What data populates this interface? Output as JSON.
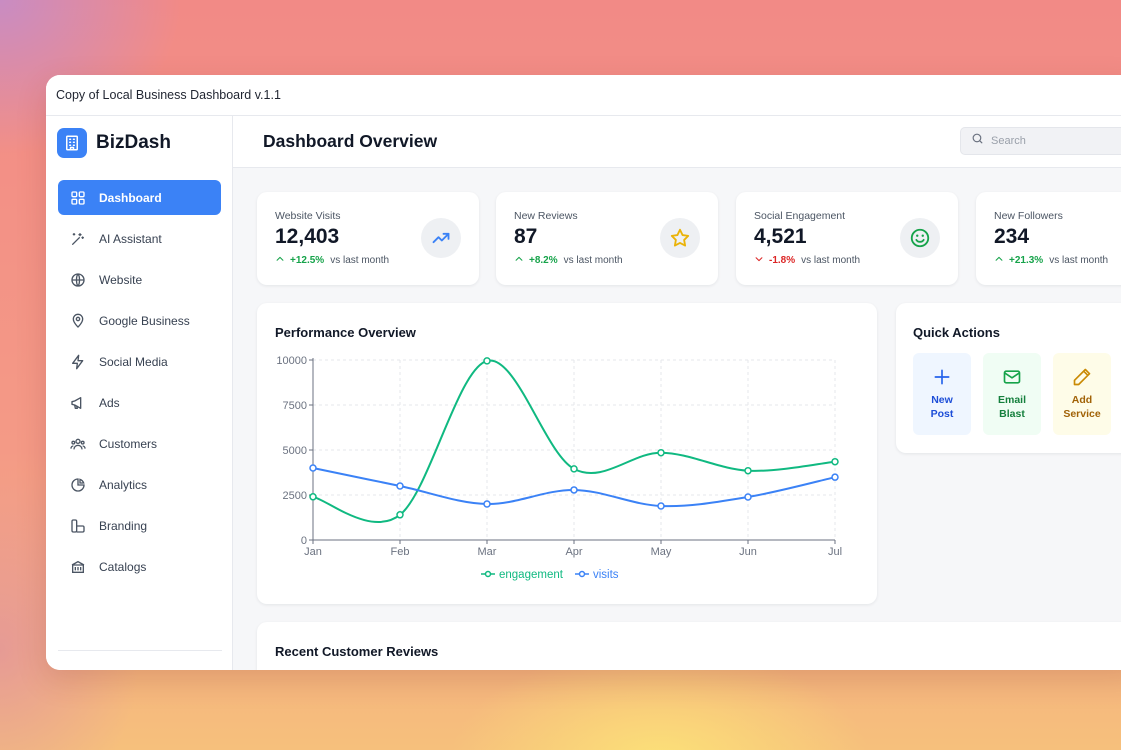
{
  "window": {
    "title": "Copy of Local Business Dashboard v.1.1"
  },
  "brand": {
    "name": "BizDash",
    "icon": "building-icon"
  },
  "sidebar": {
    "items": [
      {
        "label": "Dashboard",
        "icon": "grid-icon",
        "active": true
      },
      {
        "label": "AI Assistant",
        "icon": "sparkles-icon",
        "active": false
      },
      {
        "label": "Website",
        "icon": "globe-icon",
        "active": false
      },
      {
        "label": "Google Business",
        "icon": "map-pin-icon",
        "active": false
      },
      {
        "label": "Social Media",
        "icon": "lightning-icon",
        "active": false
      },
      {
        "label": "Ads",
        "icon": "megaphone-icon",
        "active": false
      },
      {
        "label": "Customers",
        "icon": "users-icon",
        "active": false
      },
      {
        "label": "Analytics",
        "icon": "pie-chart-icon",
        "active": false
      },
      {
        "label": "Branding",
        "icon": "palette-icon",
        "active": false
      },
      {
        "label": "Catalogs",
        "icon": "store-icon",
        "active": false
      }
    ]
  },
  "header": {
    "title": "Dashboard Overview",
    "search_placeholder": "Search"
  },
  "stats": [
    {
      "label": "Website Visits",
      "value": "12,403",
      "change": "+12.5%",
      "direction": "up",
      "suffix": "vs last month",
      "icon": "trending-up-icon",
      "icon_color": "#3b82f6"
    },
    {
      "label": "New Reviews",
      "value": "87",
      "change": "+8.2%",
      "direction": "up",
      "suffix": "vs last month",
      "icon": "star-icon",
      "icon_color": "#eab308"
    },
    {
      "label": "Social Engagement",
      "value": "4,521",
      "change": "-1.8%",
      "direction": "down",
      "suffix": "vs last month",
      "icon": "smile-icon",
      "icon_color": "#16a34a"
    },
    {
      "label": "New Followers",
      "value": "234",
      "change": "+21.3%",
      "direction": "up",
      "suffix": "vs last month",
      "icon": "users-icon",
      "icon_color": "#8b5cf6"
    }
  ],
  "performance": {
    "title": "Performance Overview",
    "chart_data": {
      "type": "line",
      "categories": [
        "Jan",
        "Feb",
        "Mar",
        "Apr",
        "May",
        "Jun",
        "Jul"
      ],
      "series": [
        {
          "name": "engagement",
          "color": "#10b981",
          "values": [
            2400,
            1400,
            9950,
            3950,
            4850,
            3850,
            4350
          ]
        },
        {
          "name": "visits",
          "color": "#3b82f6",
          "values": [
            4000,
            3000,
            2000,
            2780,
            1890,
            2390,
            3490
          ]
        }
      ],
      "yticks": [
        "0",
        "2500",
        "5000",
        "7500",
        "10000"
      ],
      "ylim": [
        0,
        10000
      ],
      "grid": true,
      "legend": "bottom"
    }
  },
  "quick_actions": {
    "title": "Quick Actions",
    "items": [
      {
        "line1": "New",
        "line2": "Post",
        "icon": "plus-icon",
        "color": "#1d4ed8",
        "bg": "#eff6ff"
      },
      {
        "line1": "Email",
        "line2": "Blast",
        "icon": "mail-icon",
        "color": "#15803d",
        "bg": "#f0fdf4"
      },
      {
        "line1": "Add",
        "line2": "Service",
        "icon": "pencil-icon",
        "color": "#a16207",
        "bg": "#fefce8"
      }
    ]
  },
  "reviews": {
    "title": "Recent Customer Reviews"
  }
}
